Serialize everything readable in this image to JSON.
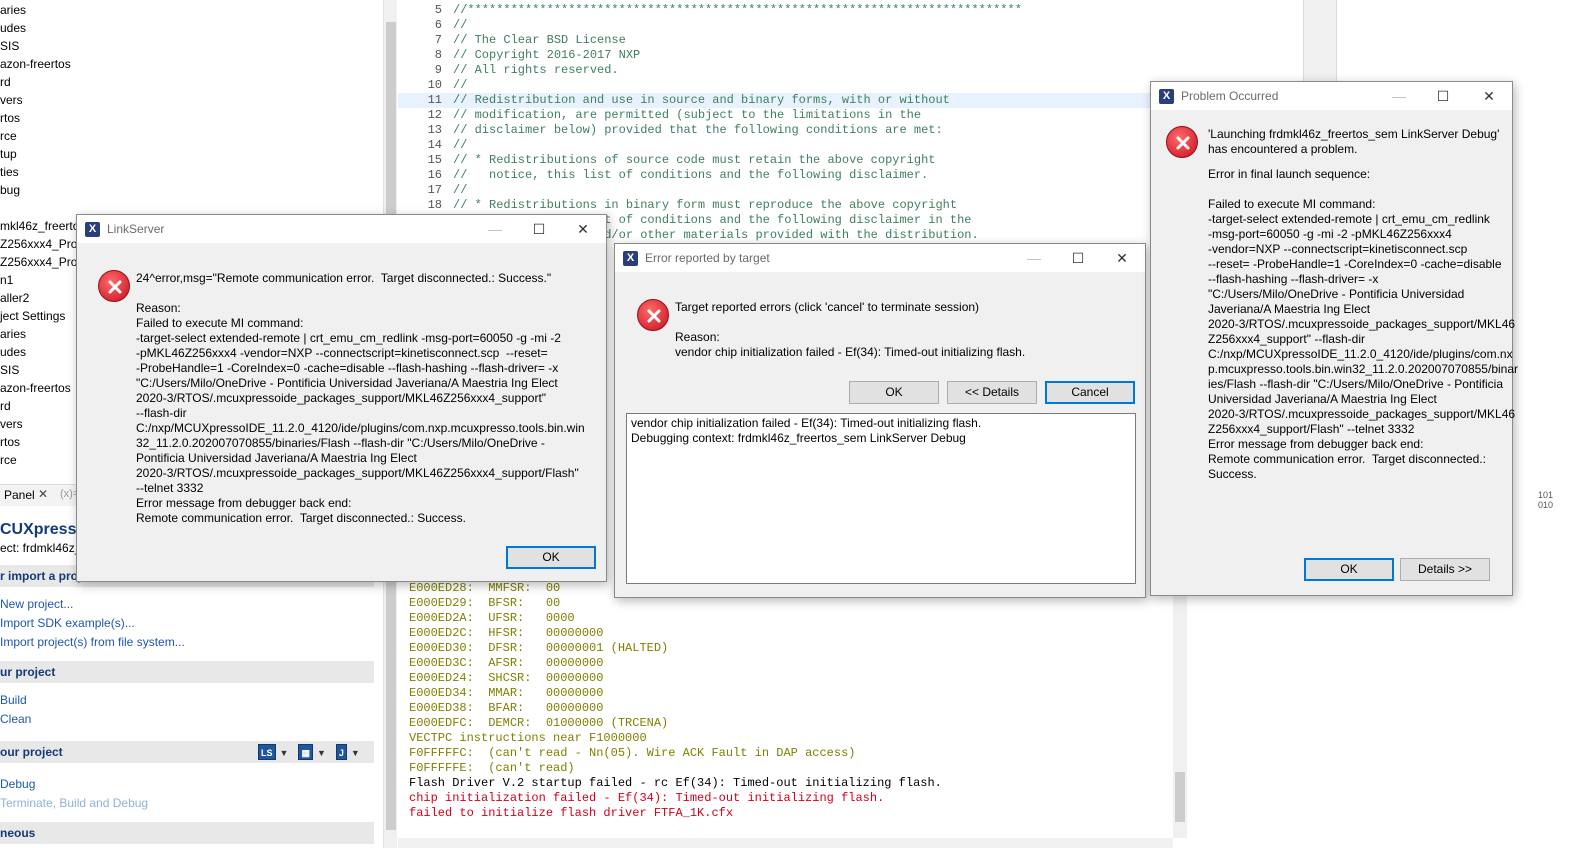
{
  "project_tree": {
    "items": [
      "aries",
      "udes",
      "SIS",
      "azon-freertos",
      "rd",
      "vers",
      "rtos",
      "rce",
      "tup",
      "ties",
      "bug",
      "",
      "mkl46z_freertos",
      "Z256xxx4_Proj",
      "Z256xxx4_Proj",
      "n1",
      "aller2",
      "ject Settings",
      "aries",
      "udes",
      "SIS",
      "azon-freertos",
      "rd",
      "vers",
      "rtos",
      "rce"
    ]
  },
  "panel": {
    "tab_label": "Panel",
    "tab_close": "✕",
    "tab_two": "(x)="
  },
  "quickstart": {
    "title": "CUXpresso",
    "project_line": "ect: frdmkl46z_",
    "section_import": "r import a proj",
    "new_project": "New project...",
    "import_sdk": "Import SDK example(s)...",
    "import_fs": "Import project(s) from file system...",
    "section_build": "ur project",
    "build": "Build",
    "clean": "Clean",
    "section_debug": "our project",
    "debug": "Debug",
    "terminate": "Terminate, Build and Debug",
    "section_misc": "neous",
    "icon_ls": "LS",
    "icon_cfg": "▦",
    "icon_j": "J"
  },
  "editor": {
    "lines": [
      {
        "n": "5",
        "t": "//*****************************************************************************"
      },
      {
        "n": "6",
        "t": "//"
      },
      {
        "n": "7",
        "t": "// The Clear BSD License"
      },
      {
        "n": "8",
        "t": "// Copyright 2016-2017 NXP"
      },
      {
        "n": "9",
        "t": "// All rights reserved."
      },
      {
        "n": "10",
        "t": "//"
      },
      {
        "n": "11",
        "t": "// Redistribution and use in source and binary forms, with or without"
      },
      {
        "n": "12",
        "t": "// modification, are permitted (subject to the limitations in the"
      },
      {
        "n": "13",
        "t": "// disclaimer below) provided that the following conditions are met:"
      },
      {
        "n": "14",
        "t": "//"
      },
      {
        "n": "15",
        "t": "// * Redistributions of source code must retain the above copyright"
      },
      {
        "n": "16",
        "t": "//   notice, this list of conditions and the following disclaimer."
      },
      {
        "n": "17",
        "t": "//"
      },
      {
        "n": "18",
        "t": "// * Redistributions in binary form must reproduce the above copyright"
      },
      {
        "n": "19",
        "t": "//   notice, this list of conditions and the following disclaimer in the"
      },
      {
        "n": "20",
        "t": "//   documentation and/or other materials provided with the distribution."
      }
    ]
  },
  "console": {
    "lines": [
      {
        "t": "E000ED28:  MMFSR:  00",
        "c": "olive"
      },
      {
        "t": "E000ED29:  BFSR:   00",
        "c": "olive"
      },
      {
        "t": "E000ED2A:  UFSR:   0000",
        "c": "olive"
      },
      {
        "t": "E000ED2C:  HFSR:   00000000",
        "c": "olive"
      },
      {
        "t": "E000ED30:  DFSR:   00000001 (HALTED)",
        "c": "olive"
      },
      {
        "t": "E000ED3C:  AFSR:   00000000",
        "c": "olive"
      },
      {
        "t": "E000ED24:  SHCSR:  00000000",
        "c": "olive"
      },
      {
        "t": "E000ED34:  MMAR:   00000000",
        "c": "olive"
      },
      {
        "t": "E000ED38:  BFAR:   00000000",
        "c": "olive"
      },
      {
        "t": "E000EDFC:  DEMCR:  01000000 (TRCENA)",
        "c": "olive"
      },
      {
        "t": "VECTPC instructions near F1000000",
        "c": "olive"
      },
      {
        "t": "F0FFFFFC:  (can't read - Nn(05). Wire ACK Fault in DAP access)",
        "c": "olive"
      },
      {
        "t": "F0FFFFFE:  (can't read)",
        "c": "olive"
      },
      {
        "t": "Flash Driver V.2 startup failed - rc Ef(34): Timed-out initializing flash.",
        "c": "black"
      },
      {
        "t": "chip initialization failed - Ef(34): Timed-out initializing flash.",
        "c": "red"
      },
      {
        "t": "failed to initialize flash driver FTFA_1K.cfx",
        "c": "red"
      }
    ]
  },
  "right_mini": "101\n010",
  "linkserver_dialog": {
    "title": "LinkServer",
    "message": "24^error,msg=\"Remote communication error.  Target disconnected.: Success.\"\n\nReason:\nFailed to execute MI command:\n-target-select extended-remote | crt_emu_cm_redlink -msg-port=60050 -g -mi -2\n-pMKL46Z256xxx4 -vendor=NXP --connectscript=kinetisconnect.scp  --reset=\n-ProbeHandle=1 -CoreIndex=0 -cache=disable --flash-hashing --flash-driver= -x\n\"C:/Users/Milo/OneDrive - Pontificia Universidad Javeriana/A Maestria Ing Elect\n2020-3/RTOS/.mcuxpressoide_packages_support/MKL46Z256xxx4_support\"\n--flash-dir\nC:/nxp/MCUXpressoIDE_11.2.0_4120/ide/plugins/com.nxp.mcuxpresso.tools.bin.win\n32_11.2.0.202007070855/binaries/Flash --flash-dir \"C:/Users/Milo/OneDrive -\nPontificia Universidad Javeriana/A Maestria Ing Elect\n2020-3/RTOS/.mcuxpressoide_packages_support/MKL46Z256xxx4_support/Flash\"\n--telnet 3332\nError message from debugger back end:\nRemote communication error.  Target disconnected.: Success.",
    "ok": "OK"
  },
  "target_dialog": {
    "title": "Error reported by target",
    "message": "Target reported errors (click 'cancel' to terminate session)\n\nReason:\nvendor chip initialization failed - Ef(34): Timed-out initializing flash.",
    "ok": "OK",
    "details": "<< Details",
    "cancel": "Cancel",
    "details_text": "vendor chip initialization failed - Ef(34): Timed-out initializing flash.\nDebugging context: frdmkl46z_freertos_sem LinkServer Debug"
  },
  "problem_dialog": {
    "title": "Problem Occurred",
    "message": "'Launching frdmkl46z_freertos_sem LinkServer Debug'\nhas encountered a problem.",
    "detail": "Error in final launch sequence:\n\nFailed to execute MI command:\n-target-select extended-remote | crt_emu_cm_redlink\n-msg-port=60050 -g -mi -2 -pMKL46Z256xxx4\n-vendor=NXP --connectscript=kinetisconnect.scp\n--reset= -ProbeHandle=1 -CoreIndex=0 -cache=disable\n--flash-hashing --flash-driver= -x\n\"C:/Users/Milo/OneDrive - Pontificia Universidad\nJaveriana/A Maestria Ing Elect\n2020-3/RTOS/.mcuxpressoide_packages_support/MKL46\nZ256xxx4_support\" --flash-dir\nC:/nxp/MCUXpressoIDE_11.2.0_4120/ide/plugins/com.nx\np.mcuxpresso.tools.bin.win32_11.2.0.202007070855/binar\nies/Flash --flash-dir \"C:/Users/Milo/OneDrive - Pontificia\nUniversidad Javeriana/A Maestria Ing Elect\n2020-3/RTOS/.mcuxpressoide_packages_support/MKL46\nZ256xxx4_support/Flash\" --telnet 3332\nError message from debugger back end:\nRemote communication error.  Target disconnected.:\nSuccess.",
    "ok": "OK",
    "details": "Details >>"
  },
  "window_controls": {
    "minimize": "—",
    "maximize": "☐",
    "close": "✕"
  }
}
